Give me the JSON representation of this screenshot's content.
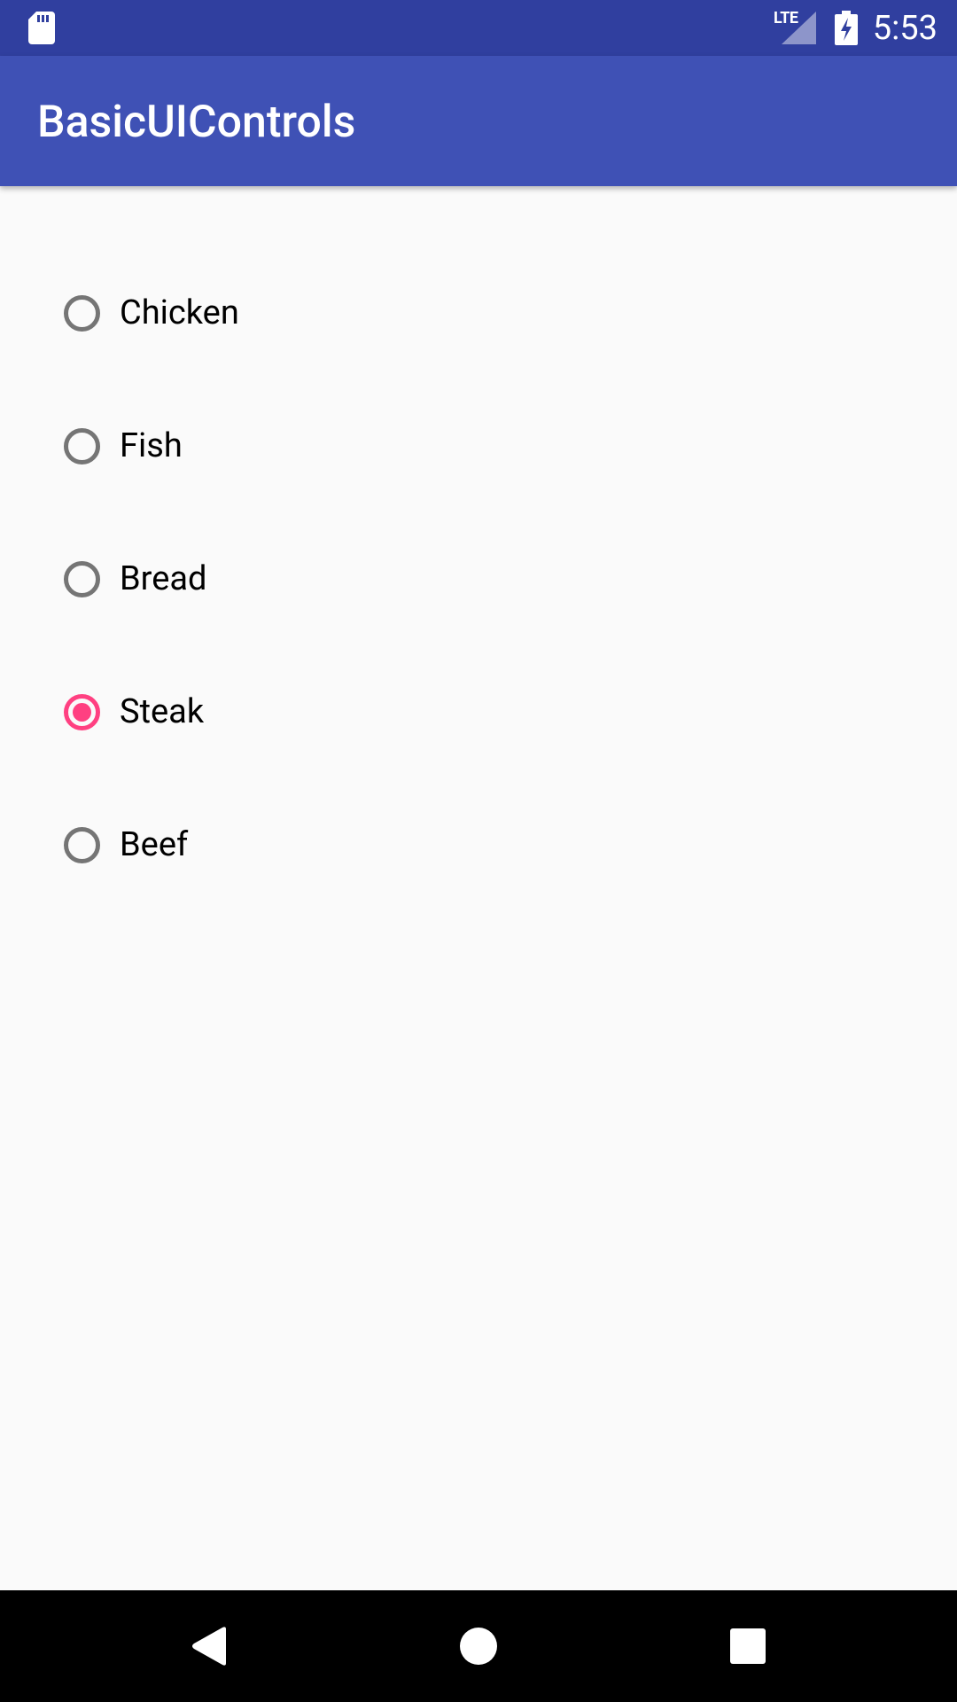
{
  "status_bar": {
    "time": "5:53",
    "network_label": "LTE",
    "icons": [
      "sd-card-icon",
      "lte-signal-icon",
      "battery-charging-icon"
    ],
    "background": "#303F9F"
  },
  "app_bar": {
    "title": "BasicUIControls",
    "background": "#3F51B5"
  },
  "radio_group": {
    "accent_color": "#FF4081",
    "unchecked_color": "#757575",
    "options": [
      {
        "label": "Chicken",
        "checked": false
      },
      {
        "label": "Fish",
        "checked": false
      },
      {
        "label": "Bread",
        "checked": false
      },
      {
        "label": "Steak",
        "checked": true
      },
      {
        "label": "Beef",
        "checked": false
      }
    ]
  },
  "nav_bar": {
    "buttons": [
      "back-icon",
      "home-icon",
      "recents-icon"
    ]
  }
}
